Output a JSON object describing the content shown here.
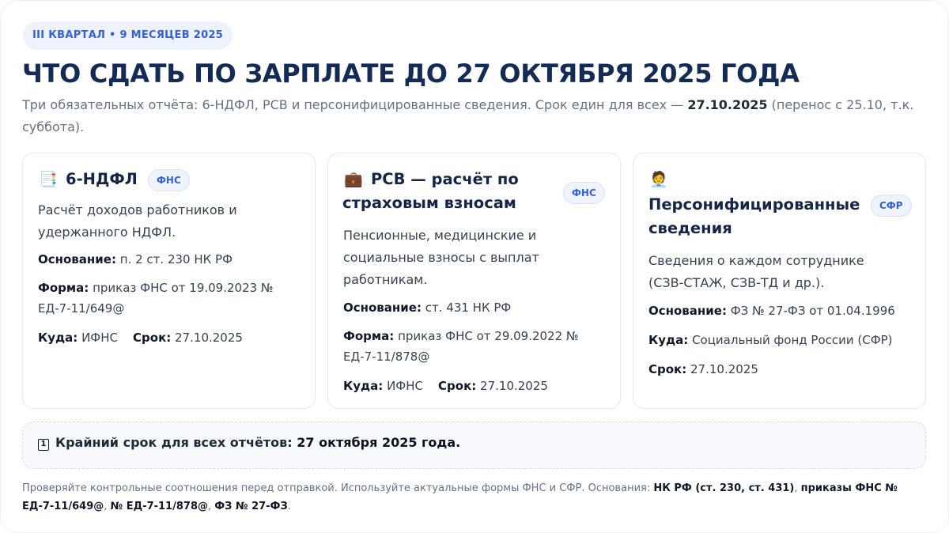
{
  "badge": "III КВАРТАЛ • 9 МЕСЯЦЕВ 2025",
  "title": "ЧТО СДАТЬ ПО ЗАРПЛАТЕ ДО 27 ОКТЯБРЯ 2025 ГОДА",
  "subtitle": {
    "pre": "Три обязательных отчёта: 6-НДФЛ, РСВ и персонифицированные сведения. Срок един для всех — ",
    "date": "27.10.2025",
    "post": " (перенос с 25.10, т.к. суббота)."
  },
  "cards": [
    {
      "icon": "📑",
      "icon_name": "document-icon",
      "title": "6-НДФЛ",
      "tag": "ФНС",
      "desc": "Расчёт доходов работников и удержанного НДФЛ.",
      "basis_label": "Основание:",
      "basis": "п. 2 ст. 230 НК РФ",
      "form_label": "Форма:",
      "form": "приказ ФНС от 19.09.2023 № ЕД-7-11/649@",
      "where_label": "Куда:",
      "where": "ИФНС",
      "due_label": "Срок:",
      "due": "27.10.2025"
    },
    {
      "icon": "💼",
      "icon_name": "briefcase-icon",
      "title": "РСВ — расчёт по страховым взносам",
      "tag": "ФНС",
      "desc": "Пенсионные, медицинские и социальные взносы с выплат работникам.",
      "basis_label": "Основание:",
      "basis": "ст. 431 НК РФ",
      "form_label": "Форма:",
      "form": "приказ ФНС от 29.09.2022 № ЕД-7-11/878@",
      "where_label": "Куда:",
      "where": "ИФНС",
      "due_label": "Срок:",
      "due": "27.10.2025"
    },
    {
      "icon": "🧑‍💼",
      "icon_name": "person-icon",
      "title": "Персонифицированные сведения",
      "tag": "СФР",
      "desc": "Сведения о каждом сотруднике (СЗВ-СТАЖ, СЗВ-ТД и др.).",
      "basis_label": "Основание:",
      "basis": "ФЗ № 27-ФЗ от 01.04.1996",
      "where_label": "Куда:",
      "where": "Социальный фонд России (СФР)",
      "due_label": "Срок:",
      "due": "27.10.2025"
    }
  ],
  "deadline": {
    "num": "1",
    "label": "Крайний срок для всех отчётов: ",
    "date": "27 октября 2025 года."
  },
  "footer": {
    "text": "Проверяйте контрольные соотношения перед отправкой. Используйте актуальные формы ФНС и СФР. Основания: ",
    "ref1": "НК РФ (ст. 230, ст. 431)",
    "sep1": ", ",
    "ref2": "приказы ФНС № ЕД-7-11/649@",
    "sep2": ", ",
    "ref3": "№ ЕД-7-11/878@",
    "sep3": ", ",
    "ref4": "ФЗ № 27-ФЗ",
    "end": "."
  }
}
